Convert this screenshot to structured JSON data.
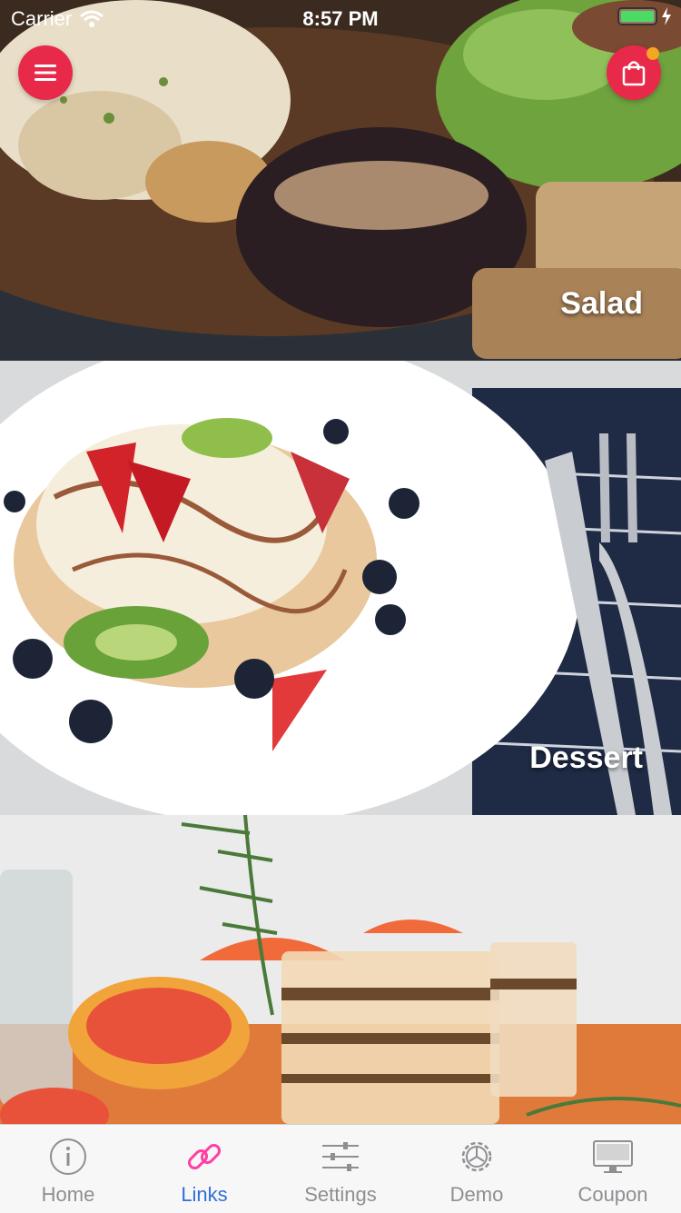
{
  "status": {
    "carrier": "Carrier",
    "time": "8:57 PM"
  },
  "cards": [
    {
      "label": "Salad"
    },
    {
      "label": "Dessert"
    },
    {
      "label": ""
    }
  ],
  "tabs": [
    {
      "label": "Home",
      "icon": "info-icon"
    },
    {
      "label": "Links",
      "icon": "link-icon"
    },
    {
      "label": "Settings",
      "icon": "sliders-icon"
    },
    {
      "label": "Demo",
      "icon": "gear-icon"
    },
    {
      "label": "Coupon",
      "icon": "monitor-icon"
    }
  ],
  "colors": {
    "accent": "#e8294a",
    "tab_active": "#2f6fd6",
    "tab_inactive": "#8e8e93",
    "links_icon": "#ff3fa4",
    "battery": "#4cd964",
    "cart_badge": "#f5a623"
  }
}
